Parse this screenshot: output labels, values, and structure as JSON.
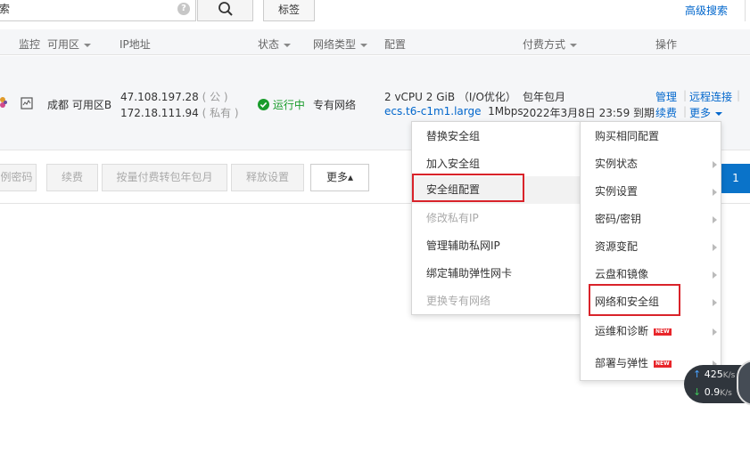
{
  "toolbar": {
    "search_text": "索",
    "help_glyph": "?",
    "tag_label": "标签",
    "advanced_search": "高级搜索"
  },
  "table": {
    "headers": {
      "monitor": "监控",
      "zone": "可用区",
      "ip": "IP地址",
      "status": "状态",
      "network_type": "网络类型",
      "config": "配置",
      "billing": "付费方式",
      "actions": "操作"
    },
    "row": {
      "zone": "成都 可用区B",
      "public_ip": "47.108.197.28",
      "public_tag": "( 公 )",
      "private_ip": "172.18.111.94",
      "private_tag": "( 私有 )",
      "status": "运行中",
      "network": "专有网络",
      "spec": "2 vCPU 2 GiB （I/O优化）",
      "instance_type": "ecs.t6-c1m1.large",
      "bandwidth": "1Mbps",
      "billing_type": "包年包月",
      "expiry": "2022年3月8日 23:59 到期",
      "actions": {
        "manage": "管理",
        "remote": "远程连接",
        "renew": "续费",
        "more": "更多"
      }
    }
  },
  "bottom_buttons": {
    "reset_password": "例密码",
    "renew": "续费",
    "convert_billing": "按量付费转包年包月",
    "release": "释放设置",
    "more": "更多▴",
    "page": "1"
  },
  "menu_left": [
    {
      "label": "替换安全组",
      "disabled": false
    },
    {
      "label": "加入安全组",
      "disabled": false
    },
    {
      "label": "安全组配置",
      "disabled": false
    },
    {
      "label": "修改私有IP",
      "disabled": true
    },
    {
      "label": "管理辅助私网IP",
      "disabled": false
    },
    {
      "label": "绑定辅助弹性网卡",
      "disabled": false
    },
    {
      "label": "更换专有网络",
      "disabled": true
    }
  ],
  "menu_right": [
    {
      "label": "购买相同配置"
    },
    {
      "label": "实例状态"
    },
    {
      "label": "实例设置"
    },
    {
      "label": "密码/密钥"
    },
    {
      "label": "资源变配"
    },
    {
      "label": "云盘和镜像"
    },
    {
      "label": "网络和安全组"
    },
    {
      "label": "运维和诊断",
      "badge": "NEW"
    },
    {
      "label": "部署与弹性",
      "badge": "NEW"
    }
  ],
  "speed_widget": {
    "upload": "425",
    "download": "0.9",
    "unit": "K/s"
  },
  "colors": {
    "link": "#0066cc",
    "running": "#1a9c2c",
    "highlight_box": "#d9232a",
    "primary": "#0a73c9"
  }
}
